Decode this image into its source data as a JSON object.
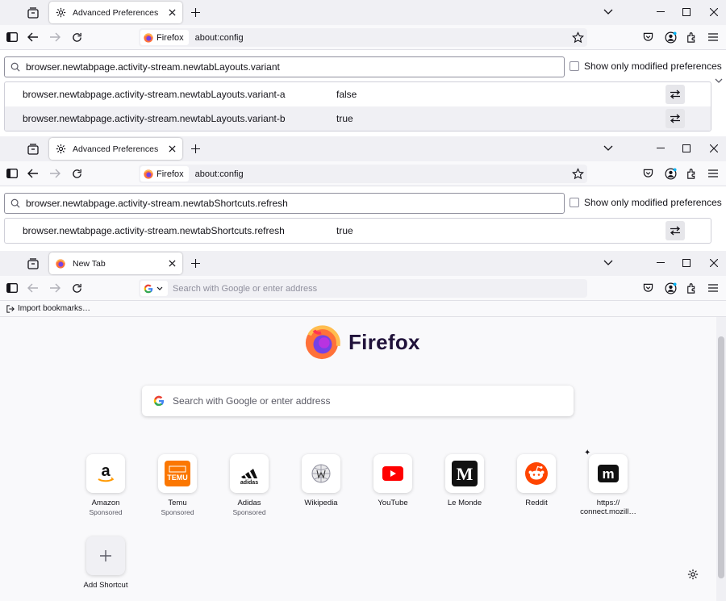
{
  "window1": {
    "tab_title": "Advanced Preferences",
    "identity": "Firefox",
    "address": "about:config",
    "search_value": "browser.newtabpage.activity-stream.newtabLayouts.variant",
    "modified_label": "Show only modified preferences",
    "rows": [
      {
        "name": "browser.newtabpage.activity-stream.newtabLayouts.variant-a",
        "value": "false"
      },
      {
        "name": "browser.newtabpage.activity-stream.newtabLayouts.variant-b",
        "value": "true"
      }
    ]
  },
  "window2": {
    "tab_title": "Advanced Preferences",
    "identity": "Firefox",
    "address": "about:config",
    "search_value": "browser.newtabpage.activity-stream.newtabShortcuts.refresh",
    "modified_label": "Show only modified preferences",
    "rows": [
      {
        "name": "browser.newtabpage.activity-stream.newtabShortcuts.refresh",
        "value": "true"
      }
    ]
  },
  "window3": {
    "tab_title": "New Tab",
    "url_placeholder": "Search with Google or enter address",
    "bookmarks_import": "Import bookmarks…",
    "brand": "Firefox",
    "search_placeholder": "Search with Google or enter address",
    "shortcuts": [
      {
        "label": "Amazon",
        "sponsor": "Sponsored"
      },
      {
        "label": "Temu",
        "sponsor": "Sponsored"
      },
      {
        "label": "Adidas",
        "sponsor": "Sponsored"
      },
      {
        "label": "Wikipedia",
        "sponsor": ""
      },
      {
        "label": "YouTube",
        "sponsor": ""
      },
      {
        "label": "Le Monde",
        "sponsor": ""
      },
      {
        "label": "Reddit",
        "sponsor": ""
      },
      {
        "label": "https://\nconnect.mozill…",
        "sponsor": ""
      }
    ],
    "add_shortcut": "Add Shortcut",
    "tile_glyphs": {
      "amazon": "a",
      "temu": "TEMU",
      "adidas": "adidas",
      "lemonde": "M",
      "mastodon": "m"
    }
  },
  "colors": {
    "accent": "#0061e0",
    "firefox_orange": "#ff7139",
    "youtube_red": "#ff0000",
    "reddit_orange": "#ff4500",
    "temu_orange": "#fb7701"
  }
}
